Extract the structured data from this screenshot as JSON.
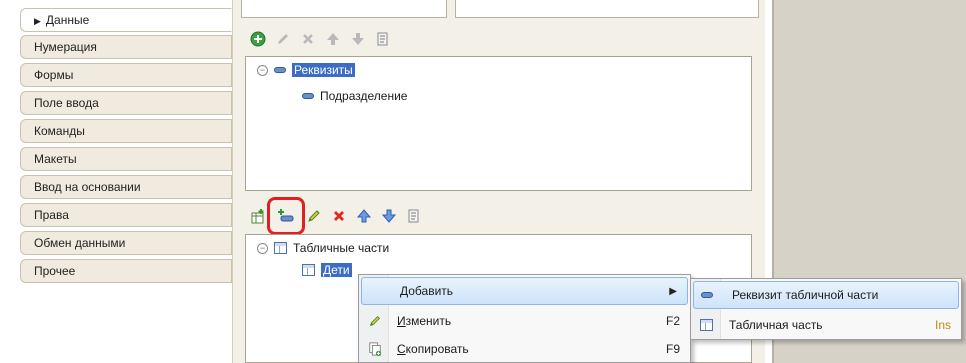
{
  "tabs": [
    {
      "label": "Данные",
      "active": true
    },
    {
      "label": "Нумерация"
    },
    {
      "label": "Формы"
    },
    {
      "label": "Поле ввода"
    },
    {
      "label": "Команды"
    },
    {
      "label": "Макеты"
    },
    {
      "label": "Ввод на основании"
    },
    {
      "label": "Права"
    },
    {
      "label": "Обмен данными"
    },
    {
      "label": "Прочее"
    }
  ],
  "attributes_tree": {
    "root": "Реквизиты",
    "child": "Подразделение"
  },
  "tabular_tree": {
    "root": "Табличные части",
    "child": "Дети"
  },
  "context_menu": {
    "add": "Добавить",
    "edit": {
      "hotkey_letter": "И",
      "rest": "зменить",
      "shortcut": "F2"
    },
    "copy": {
      "hotkey_letter": "С",
      "rest": "копировать",
      "shortcut": "F9"
    }
  },
  "submenu": {
    "item1": "Реквизит табличной части",
    "item2": "Табличная часть",
    "item2_shortcut": "Ins"
  },
  "colors": {
    "selection": "#3c6cc6",
    "highlight_frame": "#e0201f"
  }
}
